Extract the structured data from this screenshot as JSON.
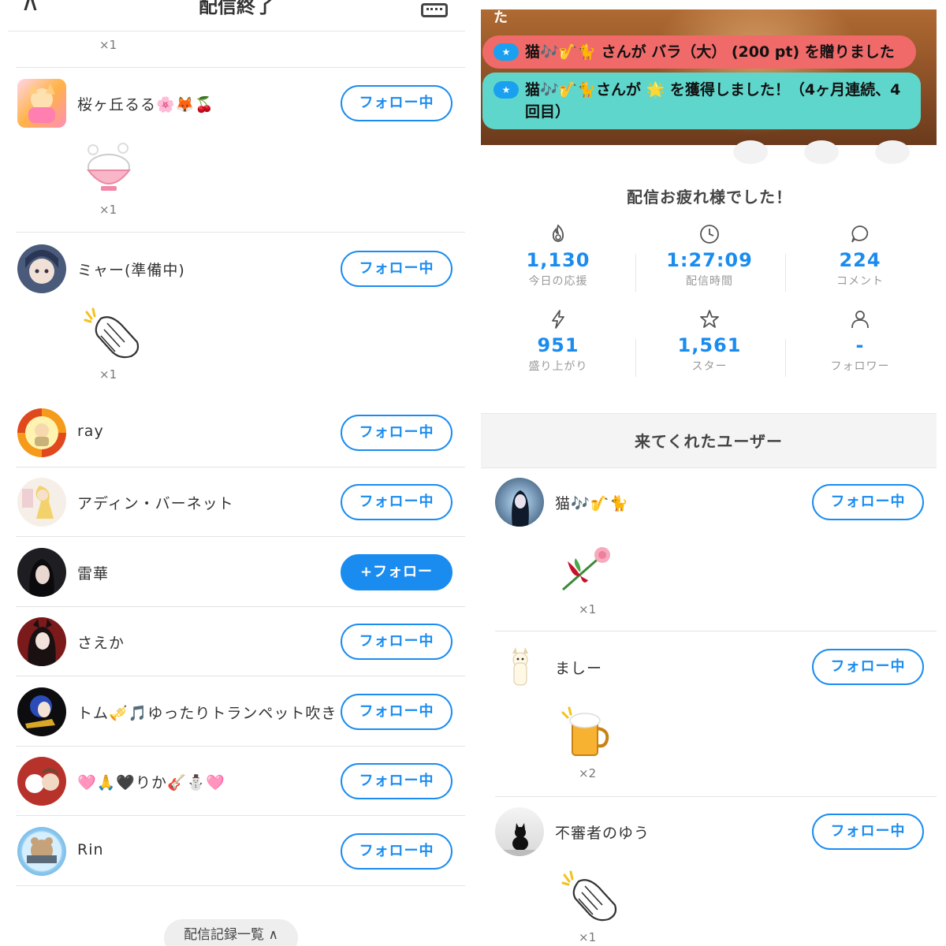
{
  "left": {
    "header": {
      "title": "配信終了"
    },
    "top_qty": "×1",
    "users": [
      {
        "name": "桜ヶ丘るる🌸🦊🍒",
        "follow": "フォロー中",
        "gift_qty": "×1",
        "gift": "rice-bowl-icon"
      },
      {
        "name": "ミャー(準備中)",
        "follow": "フォロー中",
        "gift_qty": "×1",
        "gift": "clap-icon"
      },
      {
        "name": "ray",
        "follow": "フォロー中"
      },
      {
        "name": "アディン・バーネット",
        "follow": "フォロー中"
      },
      {
        "name": "雷華",
        "follow": "+フォロー"
      },
      {
        "name": "さえか",
        "follow": "フォロー中"
      },
      {
        "name": "トム🎺🎵ゆったりトランペット吹き",
        "follow": "フォロー中"
      },
      {
        "name": "🩷🙏🖤りか🎸⛄🩷",
        "follow": "フォロー中"
      },
      {
        "name": "Rin",
        "follow": "フォロー中"
      }
    ],
    "history_button": "配信記録一覧 ∧"
  },
  "right": {
    "banner_fragment": "た",
    "notices": [
      {
        "text": "猫🎶🎷🐈 さんが バラ（大） (200 pt) を贈りました",
        "color": "#f06a6a"
      },
      {
        "text": "猫🎶🎷🐈さんが 🌟 を獲得しました！（4ヶ月連続、4回目）",
        "color": "#5fd6cc"
      }
    ],
    "done_title": "配信お疲れ様でした！",
    "stats": [
      {
        "value": "1,130",
        "label": "今日の応援",
        "icon": "flame-icon"
      },
      {
        "value": "1:27:09",
        "label": "配信時間",
        "icon": "clock-icon"
      },
      {
        "value": "224",
        "label": "コメント",
        "icon": "comment-icon"
      },
      {
        "value": "951",
        "label": "盛り上がり",
        "icon": "lightning-icon"
      },
      {
        "value": "1,561",
        "label": "スター",
        "icon": "star-icon"
      },
      {
        "value": "-",
        "label": "フォロワー",
        "icon": "person-icon"
      }
    ],
    "visitors_title": "来てくれたユーザー",
    "visitors": [
      {
        "name": "猫🎶🎷🐈",
        "follow": "フォロー中",
        "gift_qty": "×1",
        "gift": "rose-icon"
      },
      {
        "name": "ましー",
        "follow": "フォロー中",
        "gift_qty": "×2",
        "gift": "beer-icon"
      },
      {
        "name": "不審者のゆう",
        "follow": "フォロー中",
        "gift_qty": "×1",
        "gift": "clap-icon"
      }
    ]
  },
  "colors": {
    "accent": "#1a8cf0",
    "notice_red": "#f06a6a",
    "notice_teal": "#5fd6cc"
  }
}
